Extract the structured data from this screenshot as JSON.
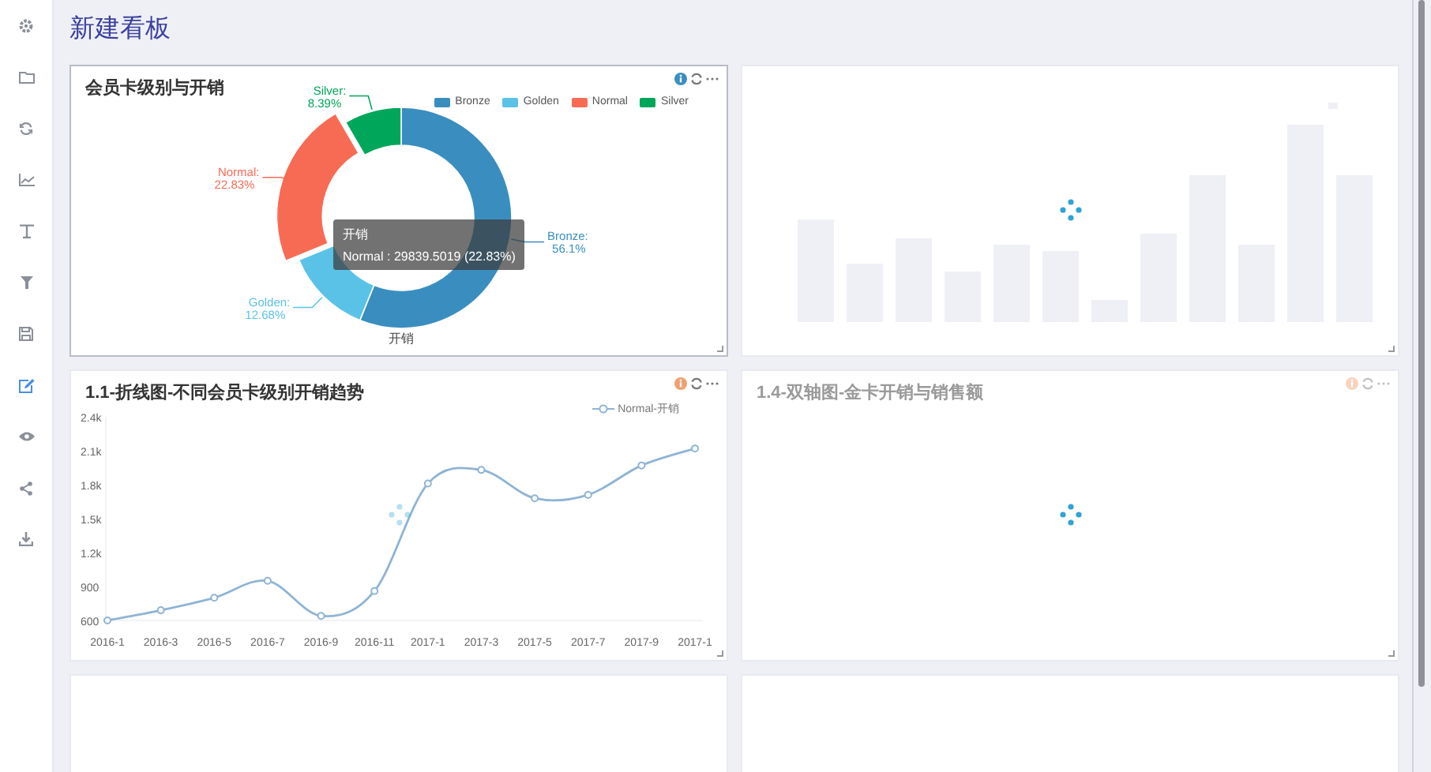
{
  "page_title": "新建看板",
  "sidebar": {
    "items": [
      {
        "selected": false
      },
      {
        "selected": false
      },
      {
        "selected": false
      },
      {
        "selected": false
      },
      {
        "selected": false
      },
      {
        "selected": false
      },
      {
        "selected": false
      },
      {
        "selected": true
      },
      {
        "selected": false
      },
      {
        "selected": false
      },
      {
        "selected": false
      }
    ]
  },
  "panels": [
    {
      "kind": "chart",
      "title": "会员卡级别与开销",
      "selected": true,
      "slices": [
        {
          "label": "Bronze:",
          "percent": "56.1%",
          "color": "#3a8ebf",
          "emphasized": false
        },
        {
          "label": "Golden:",
          "percent": "12.68%",
          "color": "#5bc2e7",
          "emphasized": false
        },
        {
          "label": "Normal:",
          "percent": "22.83%",
          "color": "#f76b55",
          "emphasized": true
        },
        {
          "label": "Silver:",
          "percent": "8.39%",
          "color": "#00a65a",
          "emphasized": false
        }
      ],
      "tooltip": {
        "title": "开销",
        "text": "Normal : 29839.5019 (22.83%)"
      },
      "chart_data": {
        "type": "donut",
        "categories": [
          "Bronze",
          "Golden",
          "Normal",
          "Silver"
        ],
        "series": [
          {
            "name": "开销",
            "values": [
              56.1,
              12.68,
              22.83,
              8.39
            ]
          }
        ]
      }
    },
    {
      "kind": "bars_skeleton",
      "selected": false,
      "loading": true
    },
    {
      "kind": "chart",
      "title": "1.1-折线图-不同会员卡级别开销趋势",
      "selected": false,
      "loading": true,
      "chart_data": {
        "type": "line",
        "categories": [
          "2016-1",
          "2016-3",
          "2016-5",
          "2016-7",
          "2016-9",
          "2016-11",
          "2017-1",
          "2017-3",
          "2017-5",
          "2017-7",
          "2017-9",
          "2017-1"
        ],
        "series": [
          {
            "name": "Normal-开销",
            "color": "#8fb4d4",
            "marker": "circle",
            "values": [
              600,
              690,
              800,
              950,
              640,
              860,
              1810,
              1930,
              1680,
              1710,
              1970,
              2120
            ]
          }
        ],
        "ylim": [
          600,
          2400
        ],
        "yticks": [
          {
            "value": 600,
            "label": "600"
          },
          {
            "value": 900,
            "label": "900"
          },
          {
            "value": 1200,
            "label": "1.2k"
          },
          {
            "value": 1500,
            "label": "1.5k"
          },
          {
            "value": 1800,
            "label": "1.8k"
          },
          {
            "value": 2100,
            "label": "2.1k"
          },
          {
            "value": 2400,
            "label": "2.4k"
          }
        ]
      }
    },
    {
      "kind": "empty",
      "title": "1.4-双轴图-金卡开销与销售额",
      "selected": false,
      "loading": true
    },
    {
      "kind": "empty",
      "selected": false
    },
    {
      "kind": "empty",
      "selected": false
    }
  ]
}
